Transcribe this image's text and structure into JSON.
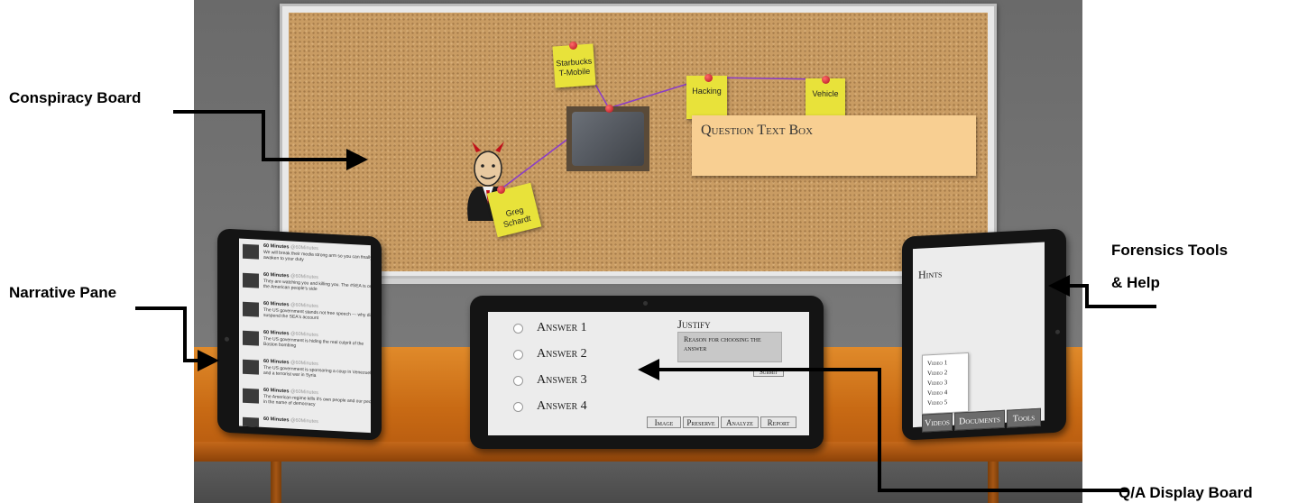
{
  "labels": {
    "conspiracy_board": "Conspiracy Board",
    "narrative_pane": "Narrative Pane",
    "forensics_line1": "Forensics Tools",
    "forensics_line2": "& Help",
    "qa_board": "Q/A Display Board"
  },
  "board": {
    "notes": {
      "starbucks_line1": "Starbucks",
      "starbucks_line2": "T-Mobile",
      "hacking": "Hacking",
      "vehicle": "Vehicle",
      "greg": "Greg Schardt"
    },
    "question_box": "Question Text Box"
  },
  "narrative": {
    "tweets": [
      {
        "name": "60 Minutes",
        "handle": "@60Minutes",
        "text": "We will break their media strong arm so you can finally awaken to your duty"
      },
      {
        "name": "60 Minutes",
        "handle": "@60Minutes",
        "text": "They are watching you and killing you. The #SEA is on the American people's side"
      },
      {
        "name": "60 Minutes",
        "handle": "@60Minutes",
        "text": "The US government stands not free speech — why did it suspend the SEA's account"
      },
      {
        "name": "60 Minutes",
        "handle": "@60Minutes",
        "text": "The US government is hiding the real culprit of the Boston bombing"
      },
      {
        "name": "60 Minutes",
        "handle": "@60Minutes",
        "text": "The US government is sponsoring a coup in Venezuela and a terrorist war in Syria"
      },
      {
        "name": "60 Minutes",
        "handle": "@60Minutes",
        "text": "The American regime kills it's own people and our people in the name of democracy"
      },
      {
        "name": "60 Minutes",
        "handle": "@60Minutes",
        "text": ""
      }
    ]
  },
  "qa": {
    "answers": [
      "Answer 1",
      "Answer 2",
      "Answer 3",
      "Answer 4"
    ],
    "justify_label": "Justify",
    "justify_text": "Reason for choosing the answer",
    "submit": "Submit",
    "buttons": [
      "Image",
      "Preserve",
      "Analyze",
      "Report"
    ]
  },
  "hints": {
    "title": "Hints",
    "videos": [
      "Video 1",
      "Video 2",
      "Video 3",
      "Video 4",
      "Video 5"
    ],
    "tabs": [
      "Videos",
      "Documents",
      "Tools"
    ]
  }
}
